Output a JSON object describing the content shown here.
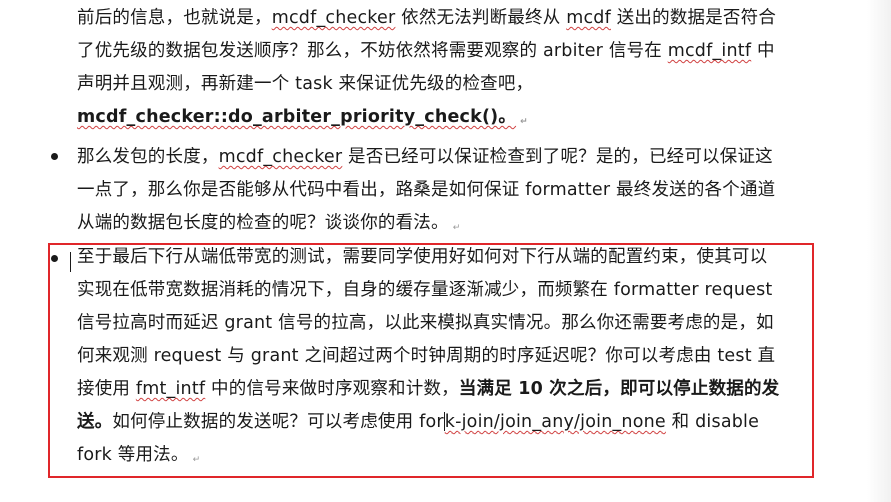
{
  "doc": {
    "para1": {
      "l1": [
        "前后的信息，也就说是，",
        "mcdf_checker",
        " 依然无法判断最终从 ",
        "mcdf",
        " 送出的数据是否符合"
      ],
      "l2": [
        "了优先级的数据包发送顺序？那么，不妨依然将需要观察的 ",
        "arbiter",
        " 信号在 ",
        "mcdf_intf",
        " 中"
      ],
      "l3": "声明并且观测，再新建一个 task 来保证优先级的检查吧，",
      "l4": "mcdf_checker::do_arbiter_priority_check()。"
    },
    "para2": {
      "l1": [
        "那么发包的长度，",
        "mcdf_checker",
        " 是否已经可以保证检查到了呢？是的，已经可以保证这"
      ],
      "l2": [
        "一点了，那么你是否能够从代码中看出，路桑是如何保证 ",
        "formatter",
        " 最终发送的各个通道"
      ],
      "l3": "从端的数据包长度的检查的呢？谈谈你的看法。"
    },
    "para3": {
      "l1": "至于最后下行从端低带宽的测试，需要同学使用好如何对下行从端的配置约束，使其可以",
      "l2": [
        "实现在低带宽数据消耗的情况下，自身的缓存量逐渐减少，而频繁在 ",
        "formatter",
        " request"
      ],
      "l3": [
        "信号拉高时而延迟 ",
        "grant",
        " 信号的拉高，以此来模拟真实情况。那么你还需要考虑的是，如"
      ],
      "l4": [
        "何来观测 ",
        "request",
        " 与 ",
        "grant",
        " 之间超过两个时钟周期的时序延迟呢？你可以考虑由 ",
        "test",
        " 直"
      ],
      "l5": [
        "接使用 ",
        "fmt_intf",
        " 中的信号来做时序观察和计数，",
        "当满足 10 次之后，即可以停止数据的发"
      ],
      "l6": [
        "送。",
        "如何停止数据的发送呢？可以考虑使用 ",
        "for",
        "k-join/join_any/join_none",
        " 和 ",
        "disable"
      ],
      "l7": "fork 等用法。"
    }
  },
  "colors": {
    "highlight_border": "#e0262a",
    "squiggle": "#d04040",
    "text": "#1a1a1a"
  }
}
